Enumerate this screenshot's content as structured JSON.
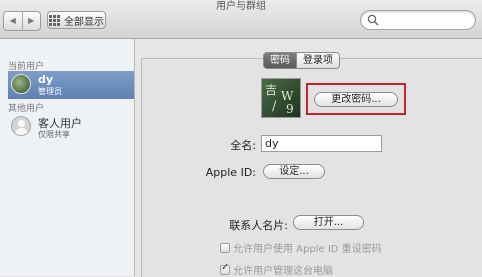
{
  "window": {
    "title": "用户与群组"
  },
  "toolbar": {
    "back_glyph": "◀",
    "forward_glyph": "▶",
    "show_all_label": "全部显示",
    "search": {
      "value": "",
      "placeholder": ""
    }
  },
  "sidebar": {
    "current_users_label": "当前用户",
    "current_user": {
      "name": "dy",
      "role": "管理员"
    },
    "other_users_label": "其他用户",
    "guest_user": {
      "name": "客人用户",
      "role": "仅限共享"
    }
  },
  "main": {
    "tabs": [
      {
        "label": "密码",
        "active": true
      },
      {
        "label": "登录项",
        "active": false
      }
    ],
    "photo_glyphs": [
      "吉",
      "W",
      "/",
      "9"
    ],
    "change_password_button": "更改密码...",
    "full_name_label": "全名:",
    "full_name_value": "dy",
    "apple_id_label": "Apple ID:",
    "apple_id_button": "设定...",
    "contact_card_label": "联系人名片:",
    "contact_card_button": "打开...",
    "checkboxes": [
      {
        "label": "允许用户使用 Apple ID 重设密码",
        "checked": false,
        "enabled": false
      },
      {
        "label": "允许用户管理这台电脑",
        "checked": true,
        "enabled": false
      }
    ]
  },
  "colors": {
    "selection": "#6f90c0",
    "highlight_frame": "#c0262b"
  }
}
